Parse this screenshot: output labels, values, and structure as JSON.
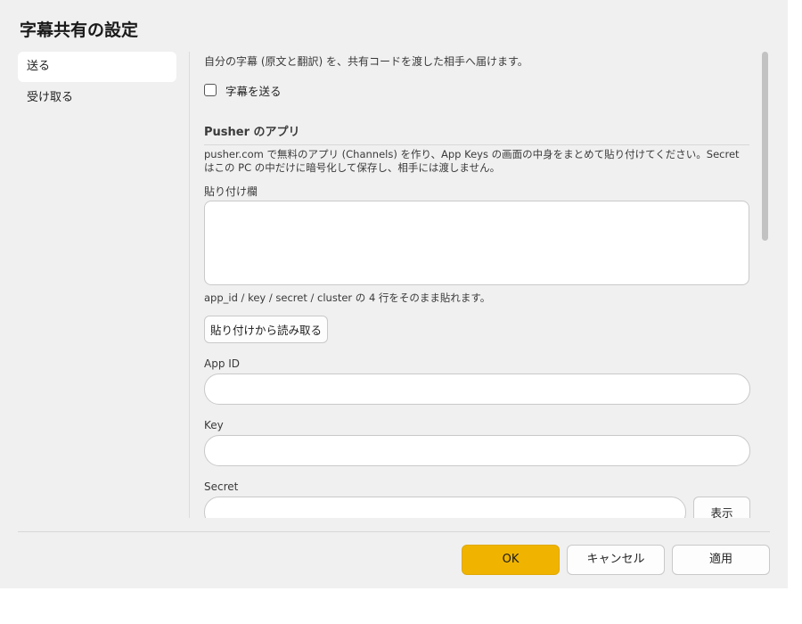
{
  "dialog": {
    "title": "字幕共有の設定"
  },
  "sidebar": {
    "items": [
      {
        "label": "送る",
        "active": true
      },
      {
        "label": "受け取る",
        "active": false
      }
    ]
  },
  "send": {
    "intro": "自分の字幕 (原文と翻訳) を、共有コードを渡した相手へ届けます。",
    "send_checkbox_label": "字幕を送る",
    "send_checkbox_checked": false,
    "pusher_heading": "Pusher のアプリ",
    "pusher_description": "pusher.com で無料のアプリ (Channels) を作り、App Keys の画面の中身をまとめて貼り付けてください。Secret はこの PC の中だけに暗号化して保存し、相手には渡しません。",
    "paste_label": "貼り付け欄",
    "paste_value": "",
    "paste_hint": "app_id / key / secret / cluster の 4 行をそのまま貼れます。",
    "read_button_label": "貼り付けから読み取る",
    "app_id_label": "App ID",
    "app_id_value": "",
    "key_label": "Key",
    "key_value": "",
    "secret_label": "Secret",
    "secret_value": "",
    "show_button_label": "表示"
  },
  "footer": {
    "ok_label": "OK",
    "cancel_label": "キャンセル",
    "apply_label": "適用"
  },
  "colors": {
    "accent": "#f0b400",
    "dialog_bg": "#f0f0f0"
  }
}
